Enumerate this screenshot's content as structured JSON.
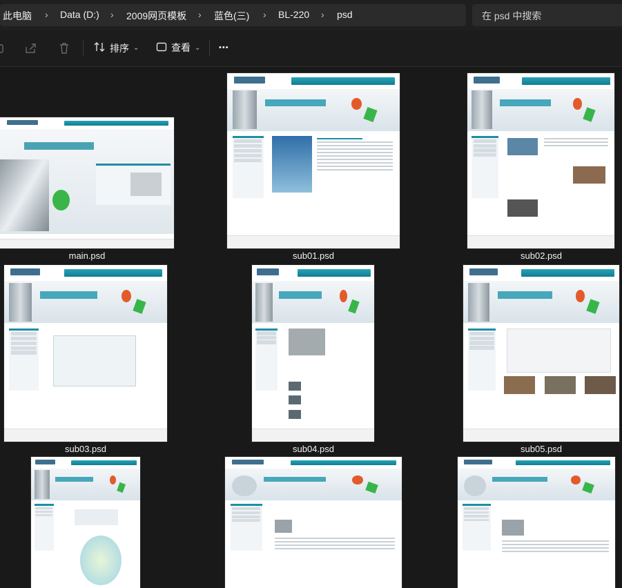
{
  "breadcrumb": [
    "此电脑",
    "Data (D:)",
    "2009网页模板",
    "蓝色(三)",
    "BL-220",
    "psd"
  ],
  "search": {
    "placeholder": "在 psd 中搜索"
  },
  "toolbar": {
    "sort_label": "排序",
    "view_label": "查看",
    "more_label": "•••"
  },
  "files": [
    {
      "name": "main.psd"
    },
    {
      "name": "sub01.psd"
    },
    {
      "name": "sub02.psd"
    },
    {
      "name": "sub03.psd"
    },
    {
      "name": "sub04.psd"
    },
    {
      "name": "sub05.psd"
    },
    {
      "name": ""
    },
    {
      "name": ""
    },
    {
      "name": ""
    }
  ],
  "colors": {
    "background": "#191919",
    "bar": "#2b2b2b",
    "accent": "#1f8ea3"
  },
  "icons": [
    "copy-icon",
    "share-icon",
    "delete-icon",
    "sort-icon",
    "view-icon",
    "more-icon"
  ]
}
